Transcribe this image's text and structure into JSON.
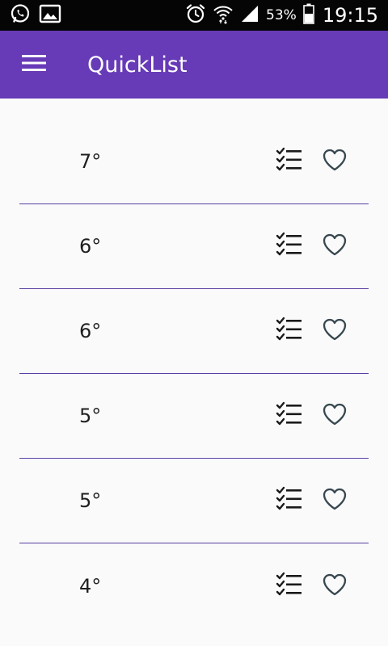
{
  "status_bar": {
    "battery_percent": "53%",
    "time": "19:15",
    "icons": [
      "whatsapp-icon",
      "gallery-icon",
      "alarm-icon",
      "wifi-icon",
      "signal-icon",
      "battery-icon"
    ]
  },
  "app_bar": {
    "title": "QuickList",
    "background": "#673ab7",
    "menu_icon": "hamburger-menu-icon"
  },
  "list": {
    "divider_color": "#5a3fa3",
    "items": [
      {
        "label": "7°",
        "actions": [
          "checklist-icon",
          "heart-icon"
        ]
      },
      {
        "label": "6°",
        "actions": [
          "checklist-icon",
          "heart-icon"
        ]
      },
      {
        "label": "6°",
        "actions": [
          "checklist-icon",
          "heart-icon"
        ]
      },
      {
        "label": "5°",
        "actions": [
          "checklist-icon",
          "heart-icon"
        ]
      },
      {
        "label": "5°",
        "actions": [
          "checklist-icon",
          "heart-icon"
        ]
      },
      {
        "label": "4°",
        "actions": [
          "checklist-icon",
          "heart-icon"
        ]
      }
    ]
  }
}
